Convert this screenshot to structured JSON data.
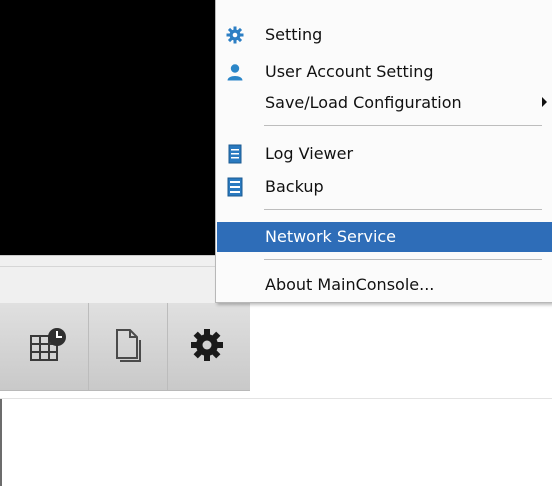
{
  "menu": {
    "items": [
      {
        "label": "Setting",
        "icon": "gear-settings-icon",
        "has_submenu": false,
        "highlighted": false
      },
      {
        "label": "User Account Setting",
        "icon": "user-icon",
        "has_submenu": false,
        "highlighted": false
      },
      {
        "label": "Save/Load Configuration",
        "icon": "",
        "has_submenu": true,
        "highlighted": false
      },
      {
        "label": "Log Viewer",
        "icon": "log-document-icon",
        "has_submenu": false,
        "highlighted": false
      },
      {
        "label": "Backup",
        "icon": "backup-icon",
        "has_submenu": false,
        "highlighted": false
      },
      {
        "label": "Network Service",
        "icon": "",
        "has_submenu": false,
        "highlighted": true
      },
      {
        "label": "About MainConsole...",
        "icon": "",
        "has_submenu": false,
        "highlighted": false
      }
    ]
  },
  "toolbar": {
    "buttons": [
      {
        "icon": "schedule-grid-icon"
      },
      {
        "icon": "document-icon"
      },
      {
        "icon": "gear-icon"
      }
    ]
  },
  "colors": {
    "highlight": "#2e6db8",
    "video_background": "#000000",
    "toolbar": "#d5d5d5"
  }
}
